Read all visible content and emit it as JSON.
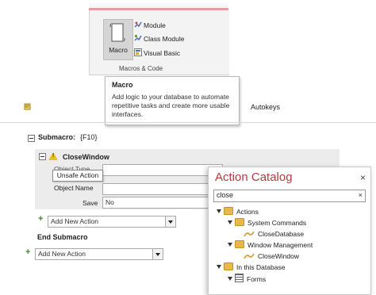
{
  "ribbon": {
    "macro_label": "Macro",
    "items": [
      {
        "label": "Module",
        "icon": "module-icon"
      },
      {
        "label": "Class Module",
        "icon": "class-module-icon"
      },
      {
        "label": "Visual Basic",
        "icon": "visual-basic-icon"
      }
    ],
    "group_label": "Macros & Code"
  },
  "tooltip": {
    "title": "Macro",
    "body": "Add logic to your database to automate repetitive tasks and create more usable interfaces."
  },
  "grid": {
    "autokeys_label": "Autokeys"
  },
  "editor": {
    "submacro_label": "Submacro:",
    "submacro_name": "{F10}",
    "action_name": "CloseWindow",
    "unsafe_tip": "Unsafe Action",
    "object_type_label": "Object Type",
    "object_name_label": "Object Name",
    "save_label": "Save",
    "save_value": "No",
    "add_action_inner": "Add New Action",
    "end_submacro": "End Submacro",
    "add_action_outer": "Add New Action"
  },
  "catalog": {
    "title": "Action Catalog",
    "search_value": "close",
    "tree": {
      "actions": "Actions",
      "system_commands": "System Commands",
      "close_database": "CloseDatabase",
      "window_management": "Window Management",
      "close_window": "CloseWindow",
      "in_this_database": "In this Database",
      "forms": "Forms"
    }
  },
  "colors": {
    "catalog_title": "#b43b3b",
    "warning": "#e8c21c",
    "add_plus": "#3a8a2c",
    "folder": "#e8b84a"
  }
}
